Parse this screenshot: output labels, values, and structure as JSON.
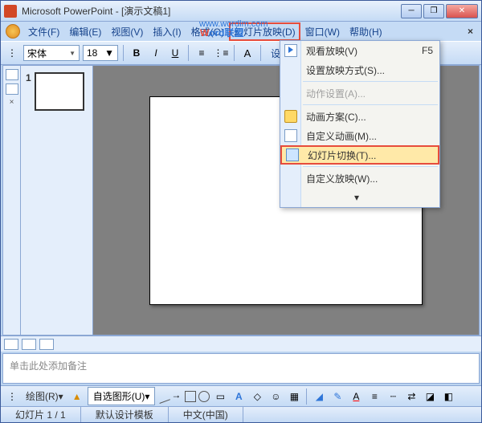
{
  "titlebar": {
    "app": "Microsoft PowerPoint",
    "doc": "[演示文稿1]"
  },
  "winbtns": {
    "min": "─",
    "max": "❐",
    "close": "✕"
  },
  "menubar": {
    "file": "文件(F)",
    "edit": "编辑(E)",
    "view": "视图(V)",
    "insert": "插入(I)",
    "format": "格式(O)",
    "slideshow": "幻灯片放映(D)",
    "window": "窗口(W)",
    "help": "帮助(H)",
    "close": "×"
  },
  "watermark": {
    "red": "W",
    "blue1": "o",
    "rest": "rd联盟",
    "url": "www.wordlm.com"
  },
  "toolbar": {
    "font": "宋体",
    "size": "18",
    "bold": "B",
    "italic": "I",
    "underline": "U",
    "design": "设计(S)"
  },
  "thumbs": {
    "num1": "1"
  },
  "dropdown": {
    "view_show": "观看放映(V)",
    "view_show_key": "F5",
    "setup_show": "设置放映方式(S)...",
    "action_settings": "动作设置(A)...",
    "animation_schemes": "动画方案(C)...",
    "custom_animation": "自定义动画(M)...",
    "slide_transition": "幻灯片切换(T)...",
    "custom_show": "自定义放映(W)...",
    "expand": "▾"
  },
  "notes": {
    "placeholder": "单击此处添加备注"
  },
  "drawbar": {
    "draw": "绘图(R)▾",
    "autoshapes": "自选图形(U)▾",
    "fontcolor": "A"
  },
  "statusbar": {
    "slide": "幻灯片 1 / 1",
    "template": "默认设计模板",
    "lang": "中文(中国)"
  }
}
